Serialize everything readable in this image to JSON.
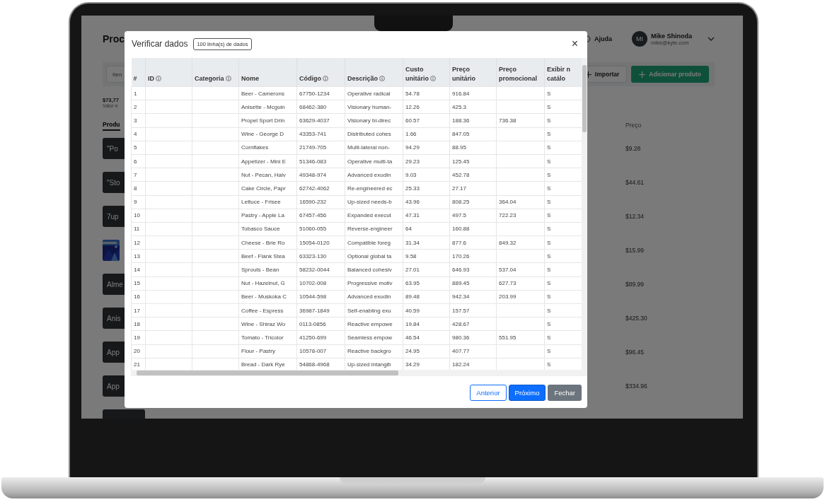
{
  "app": {
    "page_title": "Proc",
    "help": "Ajuda",
    "user": {
      "initials": "MI",
      "name": "Mike Shinoda",
      "email": "mike@kyte.com"
    },
    "search": {
      "placeholder": "Iten"
    },
    "buttons": [
      {
        "label": "Importar",
        "kind": "outline"
      },
      {
        "label": "Adicionar produto",
        "kind": "primary"
      }
    ],
    "summary": {
      "value": "$73,77",
      "caption": "Valor e"
    },
    "tab": "Produ",
    "price_header": "Preço",
    "products": [
      {
        "kind": "text",
        "label": "\"Po",
        "price": "$9.28"
      },
      {
        "kind": "text",
        "label": "\"Sto",
        "price": "$44.61"
      },
      {
        "kind": "text",
        "label": "7up",
        "price": "$12.34"
      },
      {
        "kind": "picture",
        "price": "$15.99"
      },
      {
        "kind": "text",
        "label": "Alme",
        "price": "$89.99"
      },
      {
        "kind": "text",
        "label": "Anis",
        "price": "$425.30"
      },
      {
        "kind": "text",
        "label": "App",
        "price": "$96.45"
      },
      {
        "kind": "text",
        "label": "App",
        "price": "$334.96"
      },
      {
        "kind": "blank"
      }
    ]
  },
  "modal": {
    "title": "Verificar dados",
    "badge": "100 linha(s) de dados",
    "close": "×",
    "columns": [
      {
        "label": "#",
        "info": false
      },
      {
        "label": "ID",
        "info": true
      },
      {
        "label": "Categoria",
        "info": true
      },
      {
        "label": "Nome",
        "info": false
      },
      {
        "label": "Código",
        "info": true
      },
      {
        "label": "Descrição",
        "info": true
      },
      {
        "label": "Custo\nunitário",
        "info": true
      },
      {
        "label": "Preço unitário",
        "info": false
      },
      {
        "label": "Preço\npromocional",
        "info": false
      },
      {
        "label": "Exibir n\ncatálo",
        "info": false
      }
    ],
    "rows": [
      [
        "1",
        null,
        null,
        "Beer - Camerons",
        "67750-1234",
        "Operative radical",
        "54.78",
        "916.84",
        null,
        "S"
      ],
      [
        "2",
        null,
        null,
        "Anisette - Mcguin",
        "68462-380",
        "Visionary human-",
        "12.26",
        "425.3",
        null,
        "S"
      ],
      [
        "3",
        null,
        null,
        "Propel Sport Drin",
        "63629-4037",
        "Visionary bi-direc",
        "60.57",
        "188.36",
        "736.38",
        "S"
      ],
      [
        "4",
        null,
        null,
        "Wine - George D",
        "43353-741",
        "Distributed cohes",
        "1.66",
        "847.05",
        null,
        "S"
      ],
      [
        "5",
        null,
        null,
        "Cornflakes",
        "21749-705",
        "Multi-lateral non-",
        "94.29",
        "88.95",
        null,
        "S"
      ],
      [
        "6",
        null,
        null,
        "Appetizer - Mini E",
        "51346-083",
        "Operative multi-ta",
        "29.23",
        "125.45",
        null,
        "S"
      ],
      [
        "7",
        null,
        null,
        "Nut - Pecan, Halv",
        "49348-974",
        "Advanced exudin",
        "9.03",
        "452.78",
        null,
        "S"
      ],
      [
        "8",
        null,
        null,
        "Cake Circle, Papr",
        "62742-4062",
        "Re-engineered ec",
        "25.33",
        "27.17",
        null,
        "S"
      ],
      [
        "9",
        null,
        null,
        "Lettuce - Frisee",
        "16590-232",
        "Up-sized needs-b",
        "43.96",
        "808.25",
        "364.04",
        "S"
      ],
      [
        "10",
        null,
        null,
        "Pastry - Apple La",
        "67457-456",
        "Expanded execut",
        "47.31",
        "497.5",
        "722.23",
        "S"
      ],
      [
        "11",
        null,
        null,
        "Tobasco Sauce",
        "51060-055",
        "Reverse-engineer",
        "64",
        "160.88",
        null,
        "S"
      ],
      [
        "12",
        null,
        null,
        "Cheese - Brie Ro",
        "15054-0120",
        "Compatible foreg",
        "31.34",
        "877.6",
        "849.32",
        "S"
      ],
      [
        "13",
        null,
        null,
        "Beef - Flank Stea",
        "63323-130",
        "Optional global ta",
        "9.58",
        "170.26",
        null,
        "S"
      ],
      [
        "14",
        null,
        null,
        "Sprouts - Bean",
        "58232-0044",
        "Balanced cohesiv",
        "27.01",
        "646.93",
        "537.04",
        "S"
      ],
      [
        "15",
        null,
        null,
        "Nut - Hazelnut, G",
        "10702-008",
        "Progressive motiv",
        "63.95",
        "889.45",
        "627.73",
        "S"
      ],
      [
        "16",
        null,
        null,
        "Beer - Muskoka C",
        "10544-598",
        "Advanced exudin",
        "89.48",
        "942.34",
        "203.99",
        "S"
      ],
      [
        "17",
        null,
        null,
        "Coffee - Espress",
        "36987-1849",
        "Self-enabling exu",
        "40.59",
        "157.57",
        null,
        "S"
      ],
      [
        "18",
        null,
        null,
        "Wine - Shiraz Wo",
        "0113-0856",
        "Reactive empowe",
        "19.84",
        "428.67",
        null,
        "S"
      ],
      [
        "19",
        null,
        null,
        "Tomato - Tricolor",
        "41250-699",
        "Seamless empow",
        "46.54",
        "980.36",
        "551.95",
        "S"
      ],
      [
        "20",
        null,
        null,
        "Flour - Pastry",
        "10578-007",
        "Reactive backgro",
        "24.95",
        "407.77",
        null,
        "S"
      ],
      [
        "21",
        null,
        null,
        "Bread - Dark Rye",
        "54868-4968",
        "Up-sized intangib",
        "34.29",
        "182.24",
        null,
        "S"
      ]
    ],
    "buttons": [
      {
        "label": "Anterior",
        "kind": "outline"
      },
      {
        "label": "Próximo",
        "kind": "primary"
      },
      {
        "label": "Fechar",
        "kind": "secondary"
      }
    ]
  }
}
